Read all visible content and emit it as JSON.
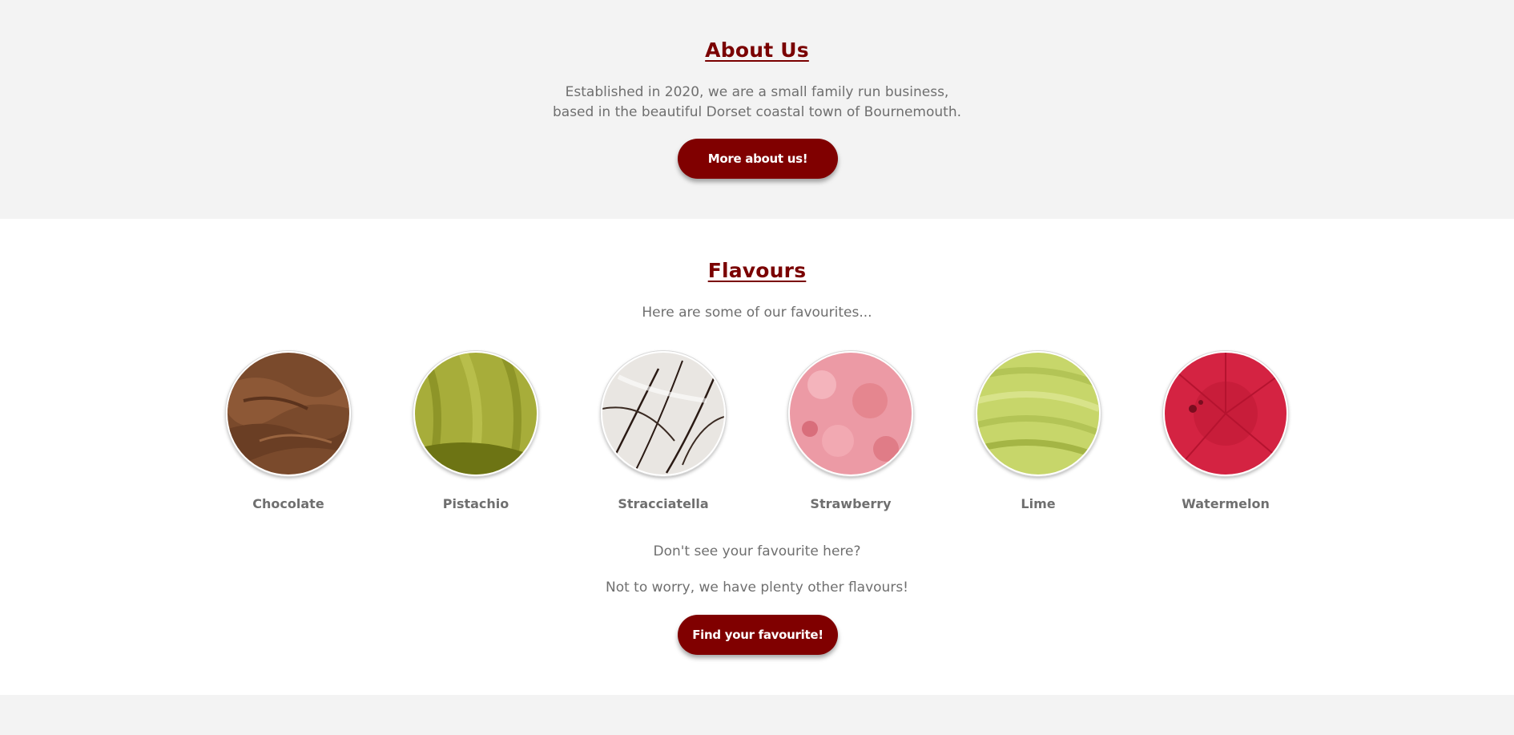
{
  "about": {
    "title": "About Us",
    "line1": "Established in 2020, we are a small family run business,",
    "line2": "based in the beautiful Dorset coastal town of Bournemouth.",
    "button": "More about us!"
  },
  "flavours": {
    "title": "Flavours",
    "subtitle": "Here are some of our favourites...",
    "items": [
      {
        "label": "Chocolate",
        "color": "#7a4a2c"
      },
      {
        "label": "Pistachio",
        "color": "#a7ad3a"
      },
      {
        "label": "Stracciatella",
        "color": "#e9e6e2"
      },
      {
        "label": "Strawberry",
        "color": "#ec9aa5"
      },
      {
        "label": "Lime",
        "color": "#c7d66a"
      },
      {
        "label": "Watermelon",
        "color": "#d42342"
      }
    ],
    "note1": "Don't see your favourite here?",
    "note2": "Not to worry, we have plenty other flavours!",
    "button": "Find your favourite!"
  },
  "colors": {
    "accent": "#800000",
    "heading": "#7a0000",
    "text": "#6f6f6f",
    "band": "#f3f3f3"
  }
}
